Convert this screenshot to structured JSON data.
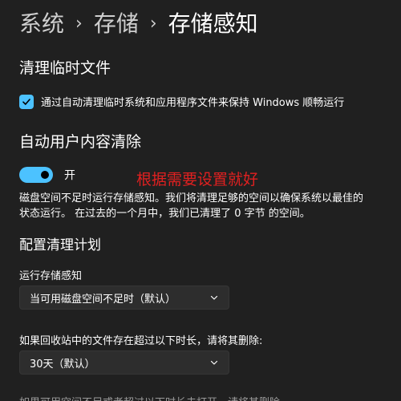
{
  "breadcrumb": {
    "items": [
      "系统",
      "存储",
      "存储感知"
    ],
    "separator": "›"
  },
  "cleanup_temp": {
    "heading": "清理临时文件",
    "checkbox_label": "通过自动清理临时系统和应用程序文件来保持 Windows 顺畅运行",
    "checked": true
  },
  "auto_cleanup": {
    "heading": "自动用户内容清除",
    "toggle_state": "开",
    "toggle_on": true,
    "description": "磁盘空间不足时运行存储感知。我们将清理足够的空间以确保系统以最佳的状态运行。 在过去的一个月中，我们已清理了 0 字节 的空间。"
  },
  "annotation": "根据需要设置就好",
  "schedule": {
    "heading": "配置清理计划",
    "run_label": "运行存储感知",
    "run_value": "当可用磁盘空间不足时（默认）",
    "recycle_label": "如果回收站中的文件存在超过以下时长，请将其删除:",
    "recycle_value": "30天（默认）"
  },
  "cut_text": "如果可用空间不足或者超过以下时长未打开，请将其删除",
  "colors": {
    "accent": "#4cc2ff",
    "background": "#202020",
    "annotation": "#e02020"
  }
}
